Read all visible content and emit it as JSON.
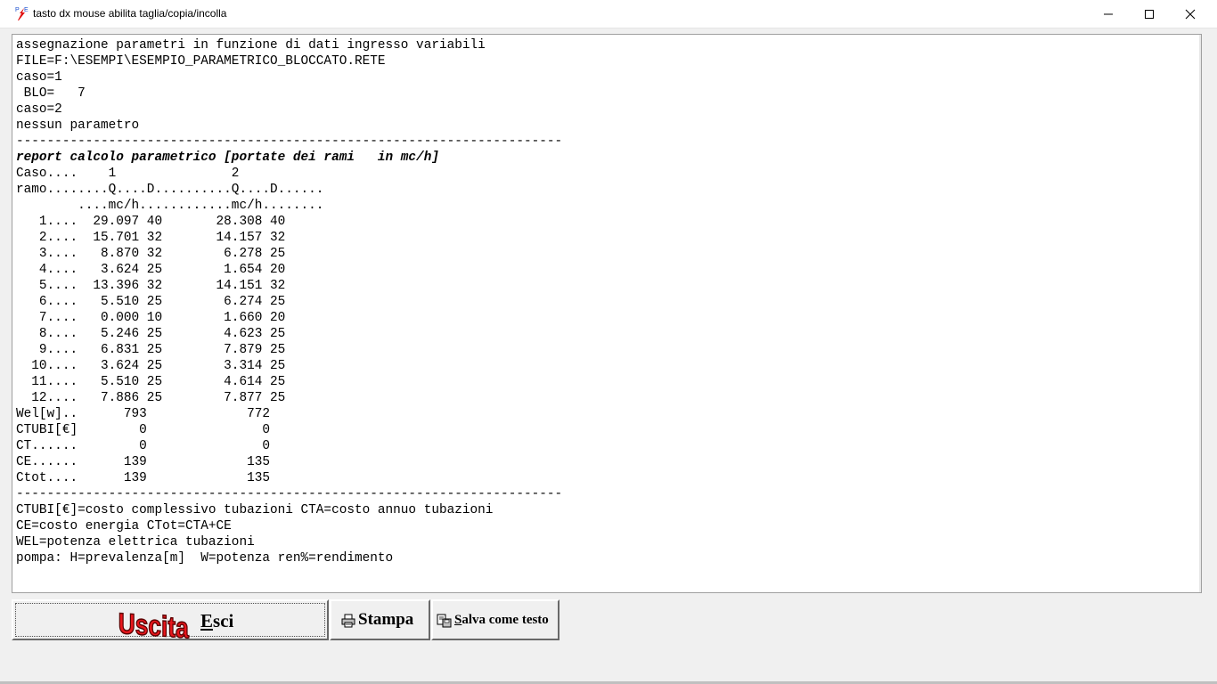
{
  "window": {
    "title": "tasto dx mouse abilita taglia/copia/incolla"
  },
  "report_lines": [
    "assegnazione parametri in funzione di dati ingresso variabili",
    "FILE=F:\\ESEMPI\\ESEMPIO_PARAMETRICO_BLOCCATO.RETE",
    "caso=1",
    " BLO=   7",
    "caso=2",
    "nessun parametro",
    "-----------------------------------------------------------------------",
    "report calcolo parametrico [portate dei rami   in mc/h]",
    "Caso....    1               2",
    "ramo........Q....D..........Q....D......",
    "        ....mc/h............mc/h........",
    "   1....  29.097 40       28.308 40",
    "   2....  15.701 32       14.157 32",
    "   3....   8.870 32        6.278 25",
    "   4....   3.624 25        1.654 20",
    "   5....  13.396 32       14.151 32",
    "   6....   5.510 25        6.274 25",
    "   7....   0.000 10        1.660 20",
    "   8....   5.246 25        4.623 25",
    "   9....   6.831 25        7.879 25",
    "  10....   3.624 25        3.314 25",
    "  11....   5.510 25        4.614 25",
    "  12....   7.886 25        7.877 25",
    "Wel[w]..      793             772",
    "CTUBI[€]        0               0",
    "CT......        0               0",
    "CE......      139             135",
    "Ctot....      139             135",
    "-----------------------------------------------------------------------",
    "CTUBI[€]=costo complessivo tubazioni CTA=costo annuo tubazioni",
    "CE=costo energia CTot=CTA+CE",
    "WEL=potenza elettrica tubazioni",
    "pompa: H=prevalenza[m]  W=potenza ren%=rendimento"
  ],
  "buttons": {
    "uscita_logo": "Uscita",
    "esci_accel": "E",
    "esci_rest": "sci",
    "stampa": "Stampa",
    "salva_accel": "S",
    "salva_rest": "alva come testo"
  },
  "colors": {
    "uscita_logo_fill": "#e8161c",
    "uscita_logo_outline": "#5a0000"
  },
  "icons": [
    "app-icon",
    "minimize-icon",
    "maximize-icon",
    "close-icon",
    "printer-icon",
    "save-text-icon"
  ]
}
